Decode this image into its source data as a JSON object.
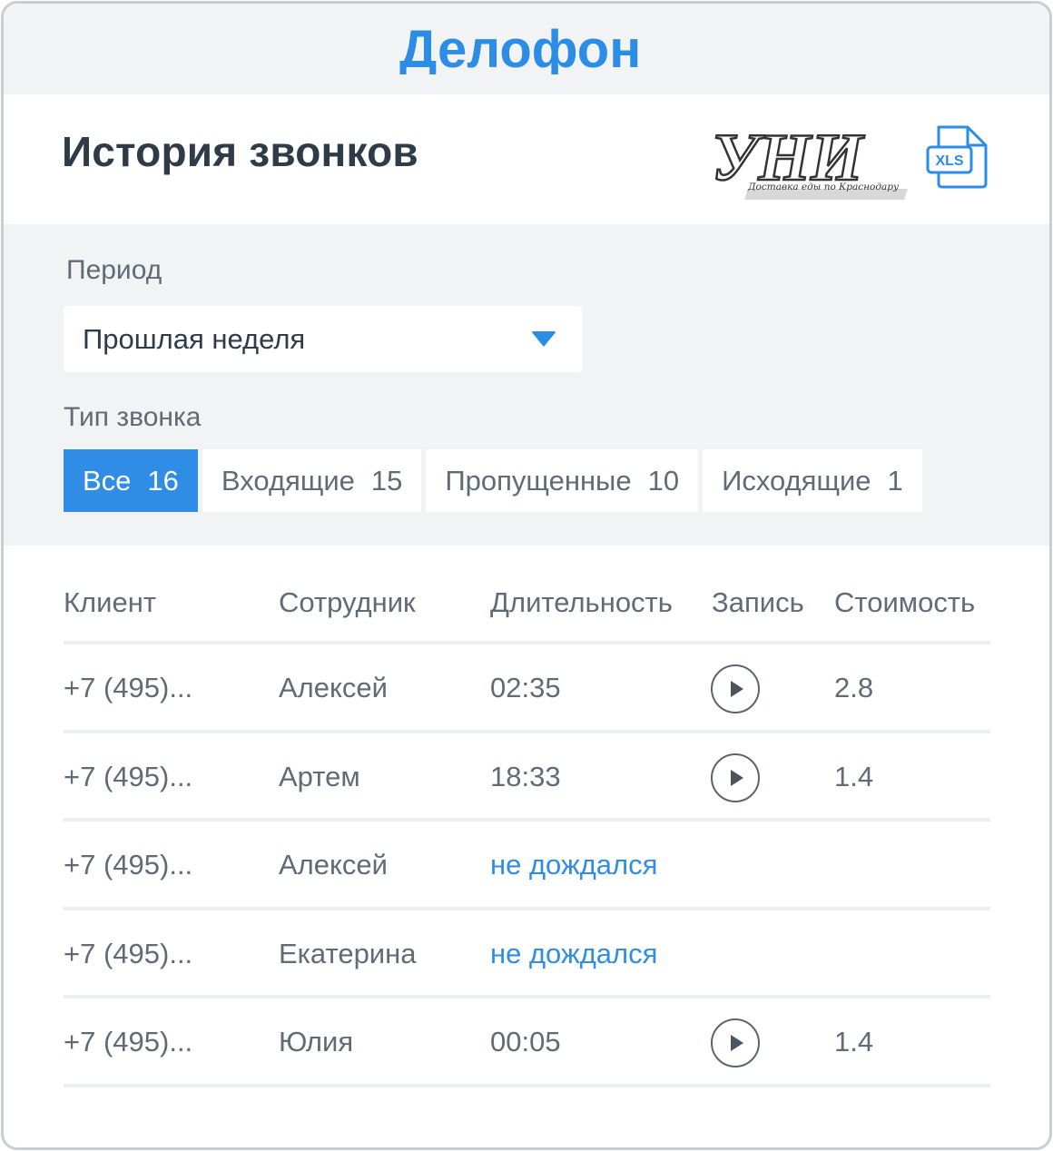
{
  "brand": {
    "name": "Делофон",
    "color": "#2b8de6"
  },
  "header": {
    "title": "История звонков",
    "client_logo": {
      "text": "УНИ",
      "tagline": "Доставка еды по Краснодару"
    },
    "export": {
      "label": "XLS",
      "icon": "xls-file-icon"
    }
  },
  "filters": {
    "period_label": "Период",
    "period_value": "Прошлая неделя",
    "type_label": "Тип звонка",
    "tabs": [
      {
        "label": "Все",
        "count": "16",
        "active": true
      },
      {
        "label": "Входящие",
        "count": "15",
        "active": false
      },
      {
        "label": "Пропущенные",
        "count": "10",
        "active": false
      },
      {
        "label": "Исходящие",
        "count": "1",
        "active": false
      }
    ]
  },
  "table": {
    "headers": [
      "Клиент",
      "Сотрудник",
      "Длительность",
      "Запись",
      "Стоимость"
    ],
    "rows": [
      {
        "client": "+7 (495)...",
        "employee": "Алексей",
        "duration": "02:35",
        "missed": false,
        "has_record": true,
        "cost": "2.8"
      },
      {
        "client": "+7 (495)...",
        "employee": "Артем",
        "duration": "18:33",
        "missed": false,
        "has_record": true,
        "cost": "1.4"
      },
      {
        "client": "+7 (495)...",
        "employee": "Алексей",
        "duration": "не дождался",
        "missed": true,
        "has_record": false,
        "cost": ""
      },
      {
        "client": "+7 (495)...",
        "employee": "Екатерина",
        "duration": "не дождался",
        "missed": true,
        "has_record": false,
        "cost": ""
      },
      {
        "client": "+7 (495)...",
        "employee": "Юлия",
        "duration": "00:05",
        "missed": false,
        "has_record": true,
        "cost": "1.4"
      }
    ]
  },
  "colors": {
    "accent": "#2f8de6",
    "text_dark": "#2f3b48",
    "text_muted": "#5f6b76",
    "panel_bg": "#f2f3f5"
  }
}
